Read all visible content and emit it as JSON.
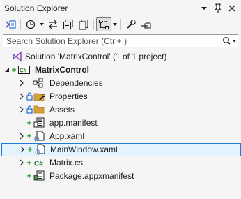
{
  "panel": {
    "title": "Solution Explorer",
    "pin_glyph": "⊓",
    "close_glyph": "✕",
    "dropdown_glyph": "▾"
  },
  "toolbar": {
    "icons": [
      "switch-views-icon",
      "history-icon",
      "sync-icon",
      "collapse-all-icon",
      "show-all-files-icon",
      "pending-changes-filter-icon",
      "properties-icon",
      "preview-icon"
    ]
  },
  "search": {
    "placeholder": "Search Solution Explorer (Ctrl+;)"
  },
  "tree": {
    "solution": "Solution 'MatrixControl' (1 of 1 project)",
    "project": "MatrixControl",
    "items": [
      {
        "label": "Dependencies"
      },
      {
        "label": "Properties"
      },
      {
        "label": "Assets"
      },
      {
        "label": "app.manifest"
      },
      {
        "label": "App.xaml"
      },
      {
        "label": "MainWindow.xaml"
      },
      {
        "label": "Matrix.cs"
      },
      {
        "label": "Package.appxmanifest"
      }
    ]
  },
  "colors": {
    "accent": "#1e7bd6",
    "git_plus": "#3a9a3a",
    "lock": "#1e6fd6",
    "folder": "#d6a23a",
    "csharp_badge": "#2e7d32",
    "vs_purple": "#7b3fb8"
  }
}
